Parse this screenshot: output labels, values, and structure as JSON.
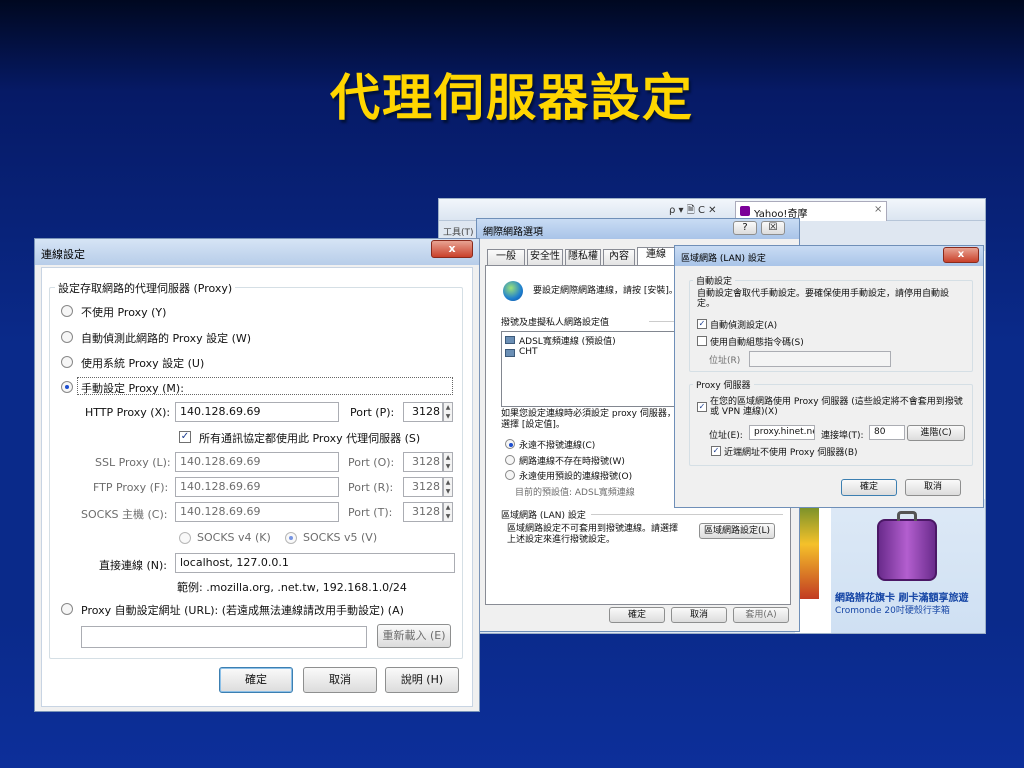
{
  "slide": {
    "title": "代理伺服器設定"
  },
  "browser": {
    "nav_icons": "ρ ▾ 🗎 C ✕",
    "tab_label": "Yahoo!奇摩",
    "tab_close": "×",
    "menu_tools": "工具(T)"
  },
  "ad": {
    "line1": "網路辦花旗卡 刷卡滿額享旅遊",
    "line2": "Cromonde 20吋硬殼行李箱"
  },
  "firefox_dialog": {
    "title": "連線設定",
    "close": "x",
    "group_label": "設定存取網路的代理伺服器 (Proxy)",
    "opt_no_proxy": "不使用 Proxy (Y)",
    "opt_auto_detect": "自動偵測此網路的 Proxy 設定 (W)",
    "opt_system": "使用系統 Proxy 設定 (U)",
    "opt_manual": "手動設定 Proxy (M):",
    "http_label": "HTTP Proxy (X):",
    "http_value": "140.128.69.69",
    "port_label_http": "Port (P):",
    "http_port": "3128",
    "all_protocols": "所有通訊協定都使用此 Proxy 代理伺服器 (S)",
    "ssl_label": "SSL Proxy (L):",
    "ssl_value": "140.128.69.69",
    "port_label_ssl": "Port (O):",
    "ssl_port": "3128",
    "ftp_label": "FTP Proxy (F):",
    "ftp_value": "140.128.69.69",
    "port_label_ftp": "Port (R):",
    "ftp_port": "3128",
    "socks_label": "SOCKS 主機 (C):",
    "socks_value": "140.128.69.69",
    "port_label_socks": "Port (T):",
    "socks_port": "3128",
    "socks_v4": "SOCKS v4 (K)",
    "socks_v5": "SOCKS v5 (V)",
    "no_proxy_label": "直接連線 (N):",
    "no_proxy_value": "localhost, 127.0.0.1",
    "example": "範例: .mozilla.org, .net.tw, 192.168.1.0/24",
    "opt_pac": "Proxy 自動設定網址 (URL): (若遠成無法連線請改用手動設定) (A)",
    "pac_url": "",
    "reload": "重新載入 (E)",
    "ok": "確定",
    "cancel": "取消",
    "help": "說明 (H)"
  },
  "ie_options": {
    "title": "網際網路選項",
    "help_btn": "?",
    "close_btn": "☒",
    "tabs": [
      "一般",
      "安全性",
      "隱私權",
      "內容",
      "連線"
    ],
    "setup_text": "要設定網際網路連線，請按 [安裝]。",
    "dialup_label": "撥號及虛擬私人網路設定值",
    "connections": [
      "ADSL寬頻連線 (預設值)",
      "CHT"
    ],
    "proxy_hint": "如果您設定連線時必須設定 proxy 伺服器，選擇 [設定值]。",
    "dial_never": "永遠不撥號連線(C)",
    "dial_no_network": "網路連線不存在時撥號(W)",
    "dial_always": "永遠使用預設的連線撥號(O)",
    "current_default": "目前的預設值:  ADSL寬頻連線",
    "lan_label": "區域網路 (LAN) 設定",
    "lan_desc": "區域網路設定不可套用到撥號連線。請選擇上述設定來進行撥號設定。",
    "lan_button": "區域網路設定(L)",
    "ok": "確定",
    "cancel": "取消",
    "apply": "套用(A)"
  },
  "lan_dialog": {
    "title": "區域網路 (LAN) 設定",
    "close": "x",
    "auto_group": "自動設定",
    "auto_desc": "自動設定會取代手動設定。要確保使用手動設定，請停用自動設定。",
    "auto_detect": "自動偵測設定(A)",
    "use_script": "使用自動組態指令碼(S)",
    "address_label": "位址(R)",
    "proxy_group": "Proxy 伺服器",
    "use_proxy": "在您的區域網路使用 Proxy 伺服器 (這些設定將不會套用到撥號或 VPN 連線)(X)",
    "proxy_address_label": "位址(E):",
    "proxy_address": "proxy.hinet.net",
    "port_label": "連接埠(T):",
    "port": "80",
    "advanced": "進階(C)",
    "bypass_local": "近端網址不使用 Proxy 伺服器(B)",
    "ok": "確定",
    "cancel": "取消"
  },
  "icons": [
    "globe-icon",
    "network-connection-icon",
    "close-icon",
    "spinner-arrows-icon",
    "suitcase-icon",
    "yahoo-favicon"
  ]
}
